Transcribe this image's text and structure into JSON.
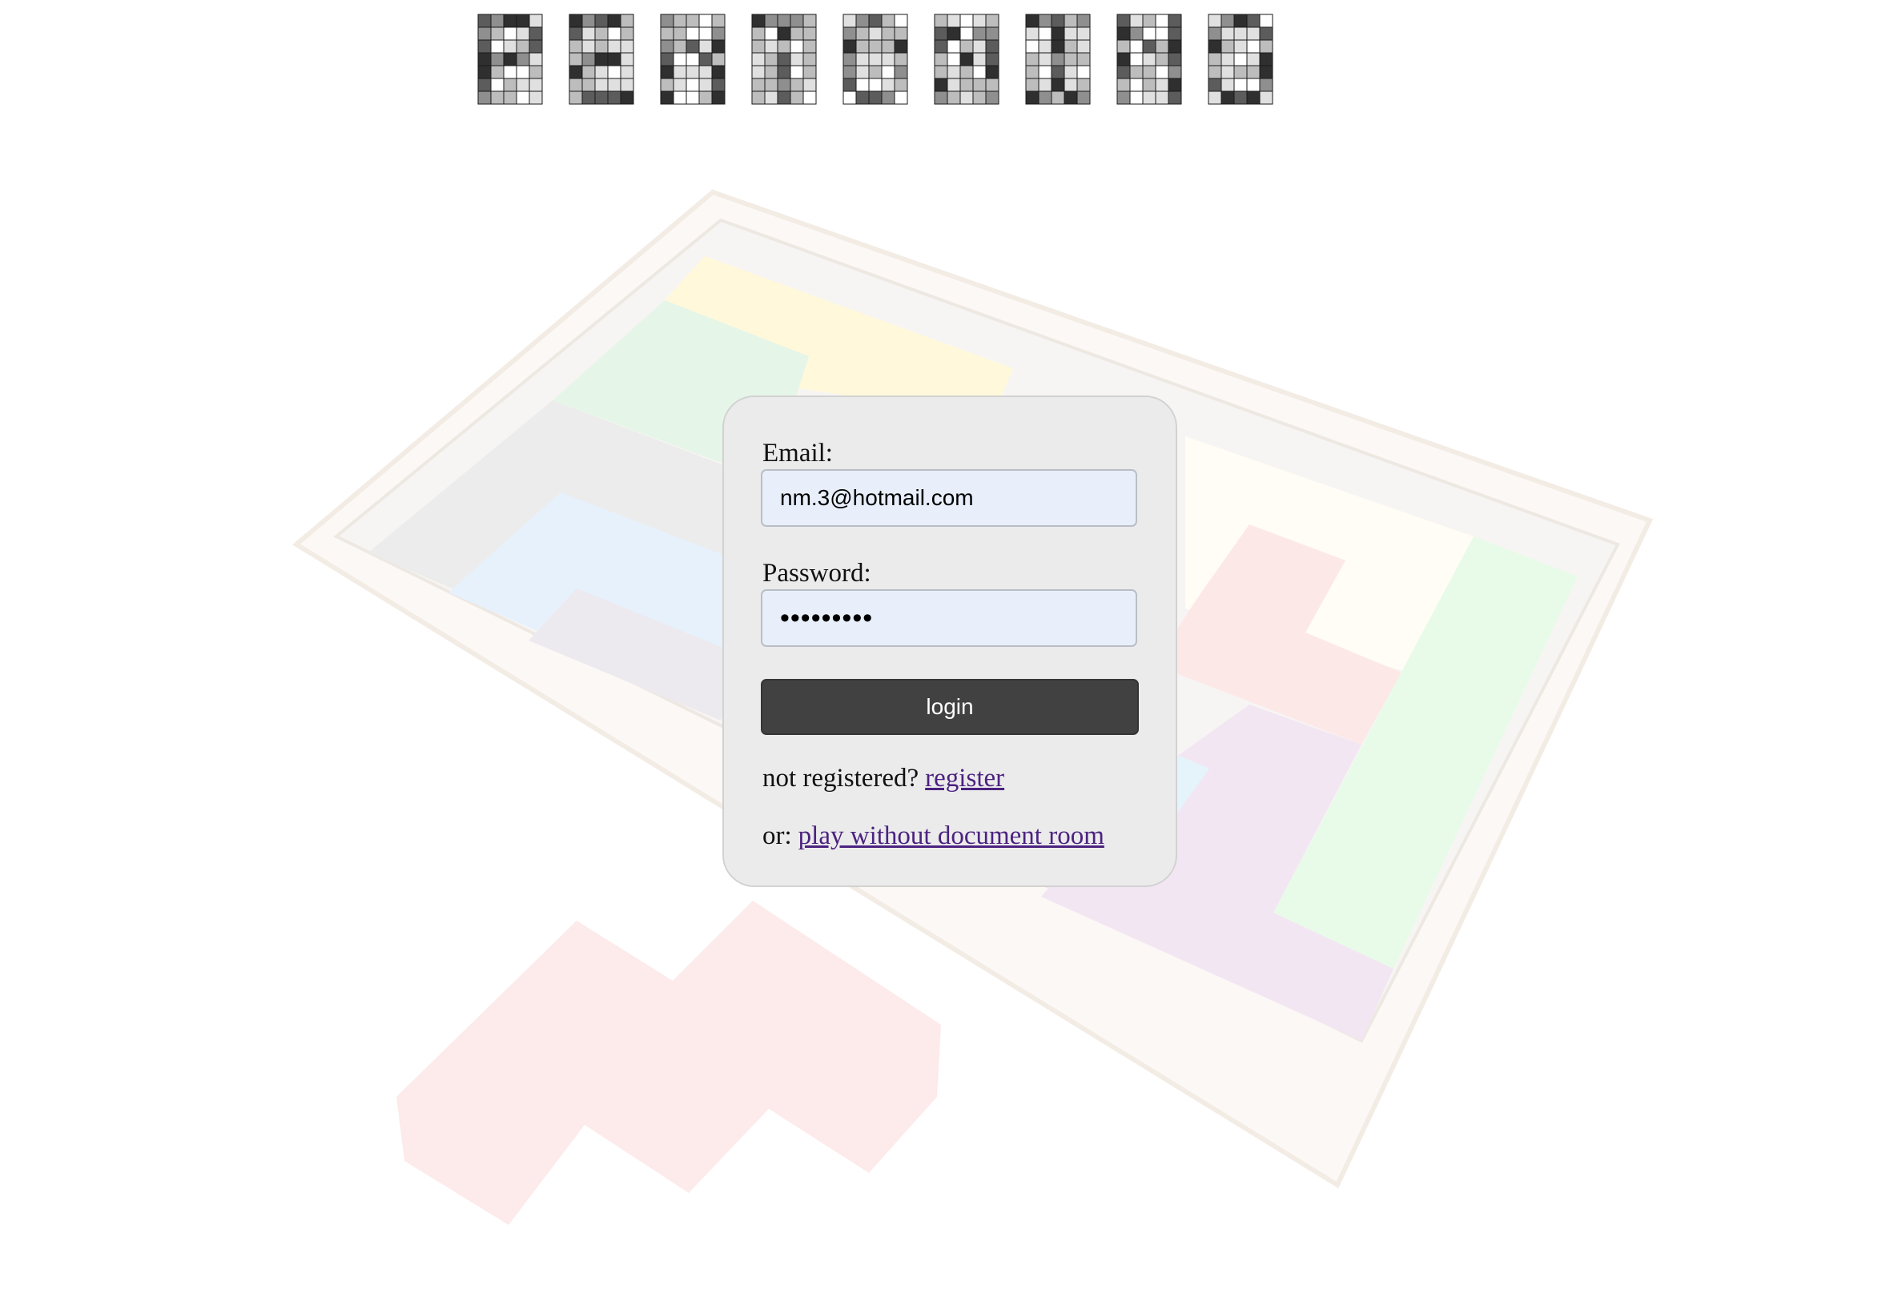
{
  "logo": {
    "word": "PENTOMINO",
    "letter_palette": [
      "#2f2f2f",
      "#5c5c5c",
      "#8f8f8f",
      "#bdbdbd",
      "#e0e0e0",
      "#ffffff"
    ]
  },
  "background": {
    "description_icon": "pentomino-wooden-box-photo",
    "tile_colors": [
      "#fff8d6",
      "#e3f4e6",
      "#e4f0fc",
      "#fde6e6",
      "#f2e4f2",
      "#e6fbe6",
      "#fffdf5",
      "#e8e8ec"
    ]
  },
  "login": {
    "email_label": "Email:",
    "email_value": "nm.3@hotmail.com",
    "password_label": "Password:",
    "password_value": "•••••••••",
    "login_button": "login",
    "register_prefix": "not registered?",
    "register_link": "register",
    "play_prefix": "or:",
    "play_link": "play without document room"
  },
  "colors": {
    "card_bg": "#ebebeb",
    "input_bg": "#e8effa",
    "button_bg": "#414141",
    "link": "#4b2280"
  }
}
